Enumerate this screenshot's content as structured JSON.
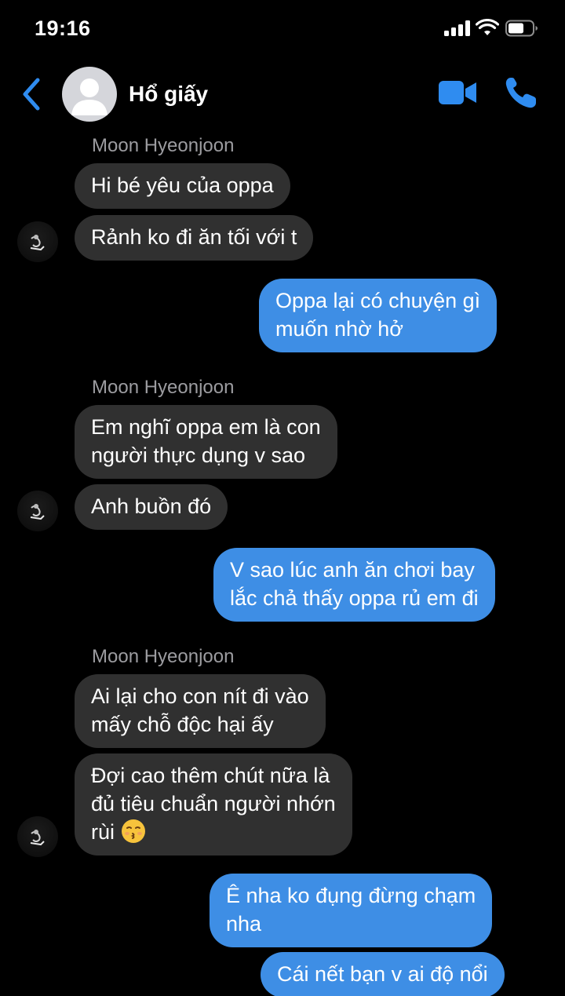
{
  "status_bar": {
    "time": "19:16"
  },
  "header": {
    "contact_name": "Hổ giấy"
  },
  "messages": [
    {
      "sender": "Moon Hyeonjoon",
      "text": "Hi bé yêu của oppa"
    },
    {
      "text": "Rảnh ko đi ăn tối với t"
    },
    {
      "line1": "Oppa lại có chuyện gì",
      "line2": "muốn nhờ hở"
    },
    {
      "sender": "Moon Hyeonjoon",
      "line1": "Em nghĩ oppa em là con",
      "line2": "người thực dụng v sao"
    },
    {
      "text": "Anh buồn đó"
    },
    {
      "line1": "V sao lúc anh ăn chơi bay",
      "line2": "lắc chả thấy oppa rủ em đi"
    },
    {
      "sender": "Moon Hyeonjoon",
      "line1": "Ai lại cho con nít đi vào",
      "line2": "mấy chỗ độc hại ấy"
    },
    {
      "line1": "Đợi cao thêm chút nữa là",
      "line2": "đủ tiêu chuẩn người nhớn",
      "line3": "rùi",
      "emoji": "kissing-face-emoji"
    },
    {
      "line1": "Ê nha ko đụng đừng chạm",
      "line2": "nha"
    },
    {
      "text": "Cái nết bạn v ai độ nổi"
    }
  ],
  "colors": {
    "outgoing_bubble": "#3e8ee5",
    "incoming_bubble": "#303030",
    "accent": "#2f8cf0"
  }
}
